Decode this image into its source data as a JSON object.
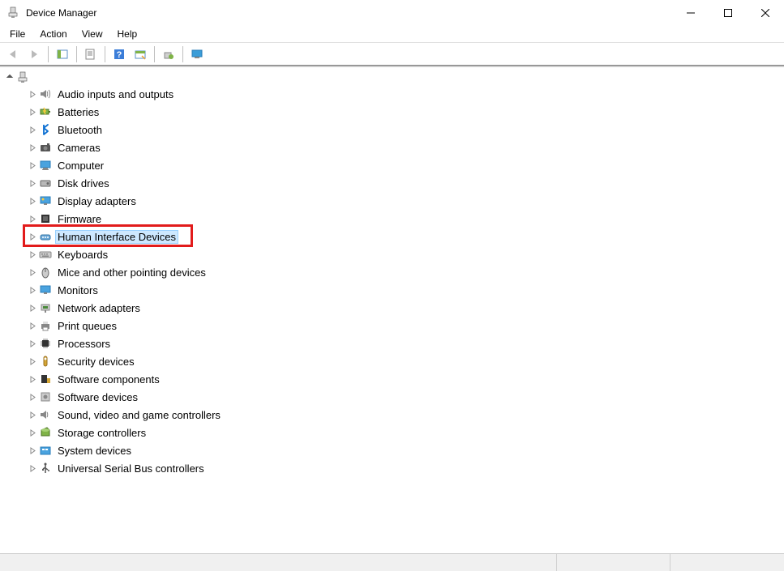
{
  "window": {
    "title": "Device Manager"
  },
  "menu": {
    "file": "File",
    "action": "Action",
    "view": "View",
    "help": "Help"
  },
  "tree": {
    "root_label": "",
    "categories": [
      {
        "label": "Audio inputs and outputs",
        "icon": "speaker"
      },
      {
        "label": "Batteries",
        "icon": "battery"
      },
      {
        "label": "Bluetooth",
        "icon": "bluetooth"
      },
      {
        "label": "Cameras",
        "icon": "camera"
      },
      {
        "label": "Computer",
        "icon": "computer"
      },
      {
        "label": "Disk drives",
        "icon": "disk"
      },
      {
        "label": "Display adapters",
        "icon": "display"
      },
      {
        "label": "Firmware",
        "icon": "firmware"
      },
      {
        "label": "Human Interface Devices",
        "icon": "hid",
        "selected": true,
        "highlighted": true
      },
      {
        "label": "Keyboards",
        "icon": "keyboard"
      },
      {
        "label": "Mice and other pointing devices",
        "icon": "mouse"
      },
      {
        "label": "Monitors",
        "icon": "monitor"
      },
      {
        "label": "Network adapters",
        "icon": "network"
      },
      {
        "label": "Print queues",
        "icon": "printer"
      },
      {
        "label": "Processors",
        "icon": "processor"
      },
      {
        "label": "Security devices",
        "icon": "security"
      },
      {
        "label": "Software components",
        "icon": "swcomp"
      },
      {
        "label": "Software devices",
        "icon": "swdev"
      },
      {
        "label": "Sound, video and game controllers",
        "icon": "sound"
      },
      {
        "label": "Storage controllers",
        "icon": "storage"
      },
      {
        "label": "System devices",
        "icon": "system"
      },
      {
        "label": "Universal Serial Bus controllers",
        "icon": "usb"
      }
    ]
  }
}
